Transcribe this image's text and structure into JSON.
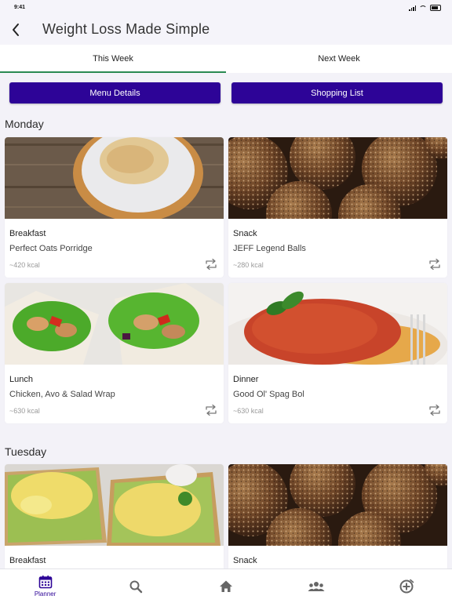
{
  "status": {
    "time": "9:41"
  },
  "header": {
    "title": "Weight Loss Made Simple"
  },
  "tabs": [
    {
      "label": "This Week",
      "active": true
    },
    {
      "label": "Next Week",
      "active": false
    }
  ],
  "buttons": {
    "menu_details": "Menu Details",
    "shopping_list": "Shopping List"
  },
  "days": [
    {
      "name": "Monday",
      "meals": [
        {
          "meal": "Breakfast",
          "name": "Perfect Oats Porridge",
          "kcal": "~420 kcal",
          "image": "porridge"
        },
        {
          "meal": "Snack",
          "name": "JEFF Legend Balls",
          "kcal": "~280 kcal",
          "image": "energy-balls"
        },
        {
          "meal": "Lunch",
          "name": "Chicken, Avo & Salad Wrap",
          "kcal": "~630 kcal",
          "image": "wrap"
        },
        {
          "meal": "Dinner",
          "name": "Good Ol' Spag Bol",
          "kcal": "~630 kcal",
          "image": "spaghetti"
        }
      ]
    },
    {
      "name": "Tuesday",
      "meals": [
        {
          "meal": "Breakfast",
          "image": "avocado-egg-toast"
        },
        {
          "meal": "Snack",
          "image": "energy-balls"
        }
      ]
    }
  ],
  "bottom_nav": [
    {
      "icon": "calendar-icon",
      "label": "Planner",
      "active": true
    },
    {
      "icon": "search-icon"
    },
    {
      "icon": "home-icon"
    },
    {
      "icon": "community-icon"
    },
    {
      "icon": "add-circle-icon"
    }
  ],
  "colors": {
    "primary": "#2d0497",
    "tab_indicator": "#2a8a52",
    "background": "#f3f2f8"
  }
}
